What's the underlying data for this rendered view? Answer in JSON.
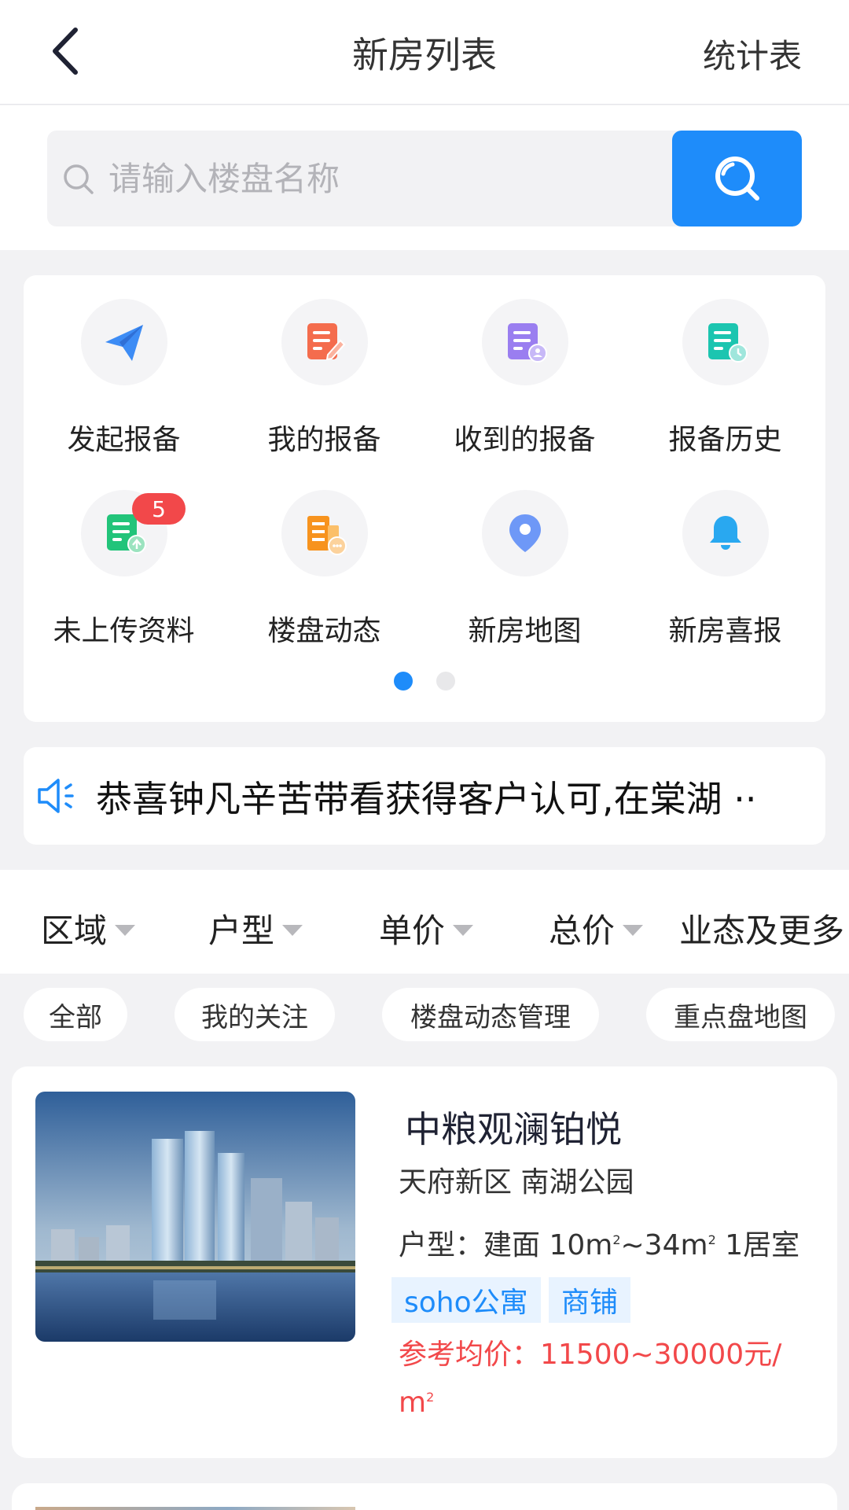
{
  "header": {
    "title": "新房列表",
    "right_action": "统计表"
  },
  "search": {
    "placeholder": "请输入楼盘名称",
    "value": ""
  },
  "quick_menu": {
    "items": [
      {
        "label": "发起报备",
        "icon": "paper-plane-icon"
      },
      {
        "label": "我的报备",
        "icon": "edit-document-icon"
      },
      {
        "label": "收到的报备",
        "icon": "received-document-icon"
      },
      {
        "label": "报备历史",
        "icon": "history-document-icon"
      },
      {
        "label": "未上传资料",
        "icon": "upload-document-icon",
        "badge": "5"
      },
      {
        "label": "楼盘动态",
        "icon": "building-chat-icon"
      },
      {
        "label": "新房地图",
        "icon": "map-pin-icon"
      },
      {
        "label": "新房喜报",
        "icon": "bell-icon"
      }
    ],
    "page_index": 1,
    "page_count": 2
  },
  "notice": {
    "text": "恭喜钟凡辛苦带看获得客户认可,在棠湖 ··",
    "icon": "speaker-icon"
  },
  "filters": [
    {
      "label": "区域",
      "has_caret": true
    },
    {
      "label": "户型",
      "has_caret": true
    },
    {
      "label": "单价",
      "has_caret": true
    },
    {
      "label": "总价",
      "has_caret": true
    },
    {
      "label": "业态及更多",
      "has_caret": false
    }
  ],
  "chips": [
    "全部",
    "我的关注",
    "楼盘动态管理",
    "重点盘地图"
  ],
  "listings": [
    {
      "name": "中粮观澜铂悦",
      "area": "天府新区 南湖公园",
      "layout_prefix": "户型：建面 10m",
      "layout_mid": "~34m",
      "layout_suffix": " 1居室",
      "sup": "2",
      "tags": [
        "soho公寓",
        "商铺"
      ],
      "price_text": "参考均价：11500~30000元/",
      "price_unit": "m"
    }
  ],
  "colors": {
    "accent": "#1e8cfa",
    "badge": "#f2484a",
    "price": "#f2484a",
    "tag_bg": "#e8f3ff"
  }
}
